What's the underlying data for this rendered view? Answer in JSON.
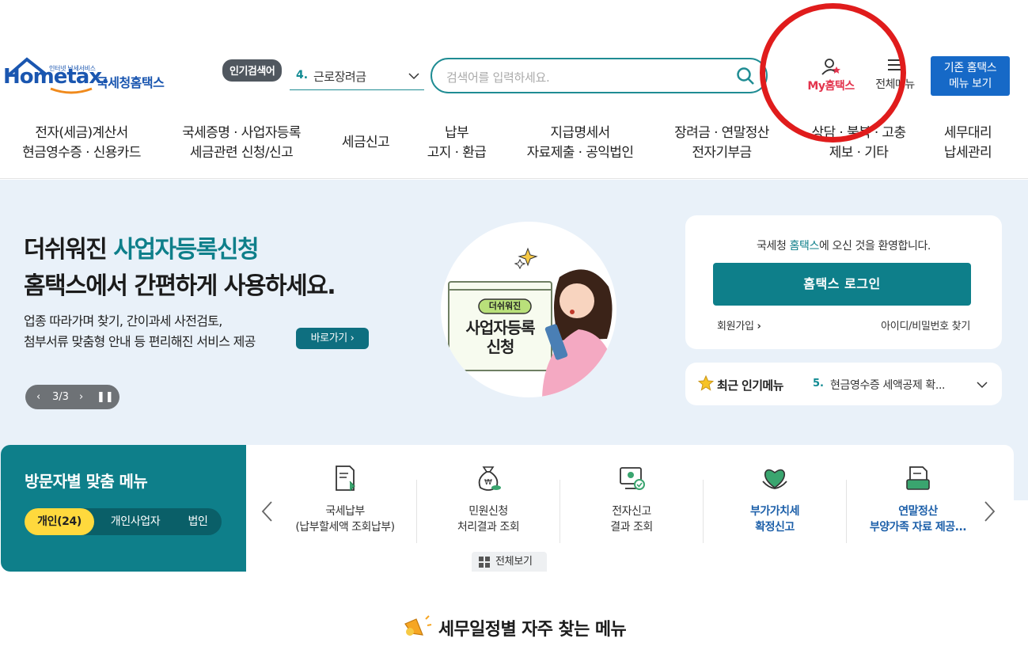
{
  "header": {
    "logo_main": "Hometax.",
    "logo_sub": "인터넷 납세서비스",
    "logo_kr": "국세청홈택스",
    "popular_badge": "인기검색어",
    "popular_num": "4.",
    "popular_text": "근로장려금",
    "search_placeholder": "검색어를 입력하세요.",
    "my_hometax": "My홈택스",
    "all_menu": "전체메뉴",
    "old_home_line1": "기존 홈택스",
    "old_home_line2": "메뉴 보기"
  },
  "gnb": [
    {
      "line1": "전자(세금)계산서",
      "line2": "현금영수증 · 신용카드"
    },
    {
      "line1": "국세증명 · 사업자등록",
      "line2": "세금관련 신청/신고"
    },
    {
      "line1": "세금신고",
      "line2": ""
    },
    {
      "line1": "납부",
      "line2": "고지 · 환급"
    },
    {
      "line1": "지급명세서",
      "line2": "자료제출 · 공익법인"
    },
    {
      "line1": "장려금 · 연말정산",
      "line2": "전자기부금"
    },
    {
      "line1": "상담 · 불복 · 고충",
      "line2": "제보 · 기타"
    },
    {
      "line1": "세무대리",
      "line2": "납세관리"
    }
  ],
  "hero": {
    "title_pre": "더쉬워진 ",
    "title_hl": "사업자등록신청",
    "title2": "홈택스에서 간편하게 사용하세요.",
    "desc1": "업종 따라가며 찾기, 간이과세 사전검토,",
    "desc2": "첨부서류 맞춤형 안내 등 편리해진 서비스 제공",
    "go_button": "바로가기",
    "pager": "3/3",
    "illus_badge": "더쉬워진",
    "illus_line1": "사업자등록",
    "illus_line2": "신청"
  },
  "login": {
    "welcome_pre": "국세청 ",
    "welcome_hl": "홈택스",
    "welcome_post": "에 오신 것을 환영합니다.",
    "login_button": "홈택스 로그인",
    "join": "회원가입",
    "find": "아이디/비밀번호 찾기"
  },
  "recent": {
    "label": "최근 인기메뉴",
    "num": "5.",
    "text": "현금영수증 세액공제 확..."
  },
  "visitor": {
    "title": "방문자별 맞춤 메뉴",
    "tabs": [
      "개인(24)",
      "개인사업자",
      "법인"
    ]
  },
  "quick_menu": [
    {
      "line1": "국세납부",
      "line2": "(납부할세액 조회납부)",
      "icon": "tax-payment-icon"
    },
    {
      "line1": "민원신청",
      "line2": "처리결과 조회",
      "icon": "money-bag-icon"
    },
    {
      "line1": "전자신고",
      "line2": "결과 조회",
      "icon": "e-filing-icon"
    },
    {
      "line1": "부가가치세",
      "line2": "확정신고",
      "icon": "vat-heart-icon"
    },
    {
      "line1": "연말정산",
      "line2": "부양가족 자료 제공...",
      "icon": "year-end-icon"
    }
  ],
  "all_view": "전체보기",
  "schedule_title": "세무일정별 자주 찾는 메뉴",
  "colors": {
    "teal": "#0e7f8a",
    "blue": "#1669c7",
    "red_annotation": "#e01c1c",
    "hero_bg": "#e9f1f9"
  }
}
